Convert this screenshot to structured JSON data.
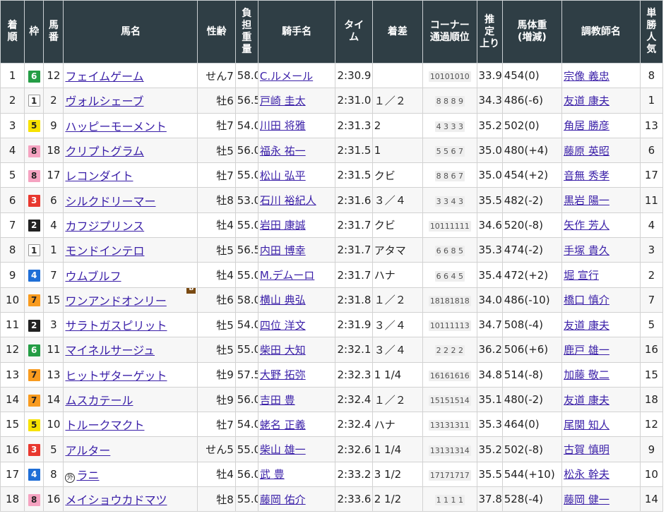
{
  "headers": {
    "rank": "着\n順",
    "frame": "枠",
    "number": "馬\n番",
    "horse": "馬名",
    "sexage": "性齢",
    "weight": "負\n担\n重\n量",
    "jockey": "騎手名",
    "time": "タイ\nム",
    "margin": "着差",
    "corner": "コーナー\n通過順位",
    "last3f": "推\n定\n上り",
    "body": "馬体重\n(増減)",
    "trainer": "調教師名",
    "pop": "単\n勝\n人\n気"
  },
  "frame_colors": {
    "1": "#ffffff",
    "2": "#222222",
    "3": "#e8382f",
    "4": "#1f6ed6",
    "5": "#f7e200",
    "6": "#249d45",
    "7": "#f89b1f",
    "8": "#f5a3c1"
  },
  "badges": {
    "blinker": "B",
    "foreign": "外"
  },
  "rows": [
    {
      "rank": "1",
      "frame": "6",
      "num": "12",
      "horse": "フェイムゲーム",
      "sexage": "せん7",
      "wt": "58.0",
      "jockey": "C.ルメール",
      "time": "2:30.9",
      "margin": "",
      "corner": "10101010",
      "last": "33.9",
      "body": "454",
      "diff": "(0)",
      "trainer": "宗像 義忠",
      "pop": "8"
    },
    {
      "rank": "2",
      "frame": "1",
      "num": "2",
      "horse": "ヴォルシェーブ",
      "sexage": "牡6",
      "wt": "56.5",
      "jockey": "戸崎 圭太",
      "time": "2:31.0",
      "margin": "１／２",
      "corner": "8 8 8 9",
      "last": "34.3",
      "body": "486",
      "diff": "(-6)",
      "trainer": "友道 康夫",
      "pop": "1"
    },
    {
      "rank": "3",
      "frame": "5",
      "num": "9",
      "horse": "ハッピーモーメント",
      "sexage": "牡7",
      "wt": "54.0",
      "jockey": "川田 将雅",
      "time": "2:31.3",
      "margin": "2",
      "corner": "4 3 3 3",
      "last": "35.2",
      "body": "502",
      "diff": "(0)",
      "trainer": "角居 勝彦",
      "pop": "13"
    },
    {
      "rank": "4",
      "frame": "8",
      "num": "18",
      "horse": "クリプトグラム",
      "sexage": "牡5",
      "wt": "56.0",
      "jockey": "福永 祐一",
      "time": "2:31.5",
      "margin": "1",
      "corner": "5 5 6 7",
      "last": "35.0",
      "body": "480",
      "diff": "(+4)",
      "trainer": "藤原 英昭",
      "pop": "6"
    },
    {
      "rank": "5",
      "frame": "8",
      "num": "17",
      "horse": "レコンダイト",
      "sexage": "牡7",
      "wt": "55.0",
      "jockey": "松山 弘平",
      "time": "2:31.5",
      "margin": "クビ",
      "corner": "8 8 6 7",
      "last": "35.0",
      "body": "454",
      "diff": "(+2)",
      "trainer": "音無 秀孝",
      "pop": "17"
    },
    {
      "rank": "6",
      "frame": "3",
      "num": "6",
      "horse": "シルクドリーマー",
      "sexage": "牡8",
      "wt": "53.0",
      "jockey": "石川 裕紀人",
      "time": "2:31.6",
      "margin": "３／４",
      "corner": "3 3 4 3",
      "last": "35.5",
      "body": "482",
      "diff": "(-2)",
      "trainer": "黒岩 陽一",
      "pop": "11"
    },
    {
      "rank": "7",
      "frame": "2",
      "num": "4",
      "horse": "カフジプリンス",
      "sexage": "牡4",
      "wt": "55.0",
      "jockey": "岩田 康誠",
      "time": "2:31.7",
      "margin": "クビ",
      "corner": "10111111",
      "last": "34.6",
      "body": "520",
      "diff": "(-8)",
      "trainer": "矢作 芳人",
      "pop": "4"
    },
    {
      "rank": "8",
      "frame": "1",
      "num": "1",
      "horse": "モンドインテロ",
      "sexage": "牡5",
      "wt": "56.5",
      "jockey": "内田 博幸",
      "time": "2:31.7",
      "margin": "アタマ",
      "corner": "6 6 8 5",
      "last": "35.3",
      "body": "474",
      "diff": "(-2)",
      "trainer": "手塚 貴久",
      "pop": "3"
    },
    {
      "rank": "9",
      "frame": "4",
      "num": "7",
      "horse": "ウムブルフ",
      "sexage": "牡4",
      "wt": "55.0",
      "jockey": "M.デムーロ",
      "time": "2:31.7",
      "margin": "ハナ",
      "corner": "6 6 4 5",
      "last": "35.4",
      "body": "472",
      "diff": "(+2)",
      "trainer": "堀 宣行",
      "pop": "2"
    },
    {
      "rank": "10",
      "frame": "7",
      "num": "15",
      "horse": "ワンアンドオンリー",
      "sexage": "牡6",
      "wt": "58.0",
      "jockey": "横山 典弘",
      "time": "2:31.8",
      "margin": "１／２",
      "corner": "18181818",
      "last": "34.0",
      "body": "486",
      "diff": "(-10)",
      "trainer": "橋口 慎介",
      "pop": "7",
      "blinker": true
    },
    {
      "rank": "11",
      "frame": "2",
      "num": "3",
      "horse": "サラトガスピリット",
      "sexage": "牡5",
      "wt": "54.0",
      "jockey": "四位 洋文",
      "time": "2:31.9",
      "margin": "３／４",
      "corner": "10111113",
      "last": "34.7",
      "body": "508",
      "diff": "(-4)",
      "trainer": "友道 康夫",
      "pop": "5"
    },
    {
      "rank": "12",
      "frame": "6",
      "num": "11",
      "horse": "マイネルサージュ",
      "sexage": "牡5",
      "wt": "55.0",
      "jockey": "柴田 大知",
      "time": "2:32.1",
      "margin": "３／４",
      "corner": "2 2 2 2",
      "last": "36.2",
      "body": "506",
      "diff": "(+6)",
      "trainer": "鹿戸 雄一",
      "pop": "16"
    },
    {
      "rank": "13",
      "frame": "7",
      "num": "13",
      "horse": "ヒットザターゲット",
      "sexage": "牡9",
      "wt": "57.5",
      "jockey": "大野 拓弥",
      "time": "2:32.3",
      "margin": "1 1/4",
      "corner": "16161616",
      "last": "34.8",
      "body": "514",
      "diff": "(-8)",
      "trainer": "加藤 敬二",
      "pop": "15"
    },
    {
      "rank": "14",
      "frame": "7",
      "num": "14",
      "horse": "ムスカテール",
      "sexage": "牡9",
      "wt": "56.0",
      "jockey": "吉田 豊",
      "time": "2:32.4",
      "margin": "１／２",
      "corner": "15151514",
      "last": "35.1",
      "body": "480",
      "diff": "(-2)",
      "trainer": "友道 康夫",
      "pop": "18"
    },
    {
      "rank": "15",
      "frame": "5",
      "num": "10",
      "horse": "トルークマクト",
      "sexage": "牡7",
      "wt": "54.0",
      "jockey": "蛯名 正義",
      "time": "2:32.4",
      "margin": "ハナ",
      "corner": "13131311",
      "last": "35.3",
      "body": "464",
      "diff": "(0)",
      "trainer": "尾関 知人",
      "pop": "12"
    },
    {
      "rank": "16",
      "frame": "3",
      "num": "5",
      "horse": "アルター",
      "sexage": "せん5",
      "wt": "55.0",
      "jockey": "柴山 雄一",
      "time": "2:32.6",
      "margin": "1 1/4",
      "corner": "13131314",
      "last": "35.2",
      "body": "502",
      "diff": "(-8)",
      "trainer": "古賀 慎明",
      "pop": "9"
    },
    {
      "rank": "17",
      "frame": "4",
      "num": "8",
      "horse": "ラニ",
      "sexage": "牡4",
      "wt": "56.0",
      "jockey": "武 豊",
      "time": "2:33.2",
      "margin": "3 1/2",
      "corner": "17171717",
      "last": "35.5",
      "body": "544",
      "diff": "(+10)",
      "trainer": "松永 幹夫",
      "pop": "10",
      "foreign": true
    },
    {
      "rank": "18",
      "frame": "8",
      "num": "16",
      "horse": "メイショウカドマツ",
      "sexage": "牡8",
      "wt": "55.0",
      "jockey": "藤岡 佑介",
      "time": "2:33.6",
      "margin": "2 1/2",
      "corner": "1 1 1 1",
      "last": "37.8",
      "body": "528",
      "diff": "(-4)",
      "trainer": "藤岡 健一",
      "pop": "14"
    }
  ]
}
